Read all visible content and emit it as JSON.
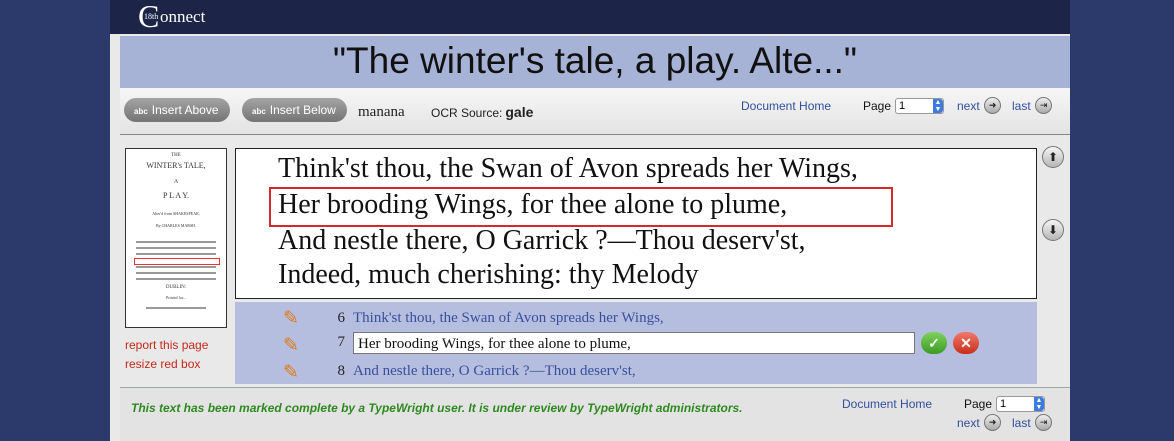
{
  "app": {
    "logo_text": "onnect",
    "logo_letter": "C",
    "logo_number": "18th"
  },
  "document": {
    "title": "\"The winter's tale, a play. Alte...\""
  },
  "toolbar": {
    "insert_above": "Insert Above",
    "insert_below": "Insert Below",
    "button_icon_text": "abc",
    "user": "manana",
    "ocr_source_label": "OCR Source:",
    "ocr_source_value": "gale",
    "document_home": "Document Home",
    "page_label": "Page",
    "page_value": "1",
    "next": "next",
    "last": "last"
  },
  "thumbnail": {
    "lines": [
      "THE",
      "WINTER's TALE,",
      "A",
      "P L A Y.",
      "Alter'd from SHAKESPEAR,",
      "By CHARLES MARSH.",
      "DUBLIN:",
      "Printed for..."
    ]
  },
  "sidebar": {
    "report_link": "report this page",
    "resize_link": "resize red box"
  },
  "scan": {
    "lines": [
      "Think'st thou, the Swan of Avon spreads her Wings,",
      "Her brooding Wings, for thee alone to plume,",
      "And nestle there, O Garrick ?—Thou deserv'st,",
      "Indeed, much cherishing: thy Melody"
    ]
  },
  "edit": {
    "lines": [
      {
        "num": "6",
        "text": "Think'st thou, the Swan of Avon spreads her Wings,"
      },
      {
        "num": "7",
        "text": "Her brooding Wings, for thee alone to plume,"
      },
      {
        "num": "8",
        "text": "And nestle there, O Garrick ?—Thou deserv'st,"
      }
    ],
    "active_index": 1
  },
  "footer": {
    "complete_message": "This text has been marked complete by a TypeWright user. It is under review by TypeWright administrators.",
    "document_home": "Document Home",
    "page_label": "Page",
    "page_value": "1",
    "next": "next",
    "last": "last"
  },
  "colors": {
    "background": "#2b3a6a",
    "title_band": "#a6b3d6",
    "edit_panel": "#b6bee0",
    "link": "#334f9c",
    "red_box": "#d42a2a",
    "complete_text": "#2e8a1f"
  }
}
